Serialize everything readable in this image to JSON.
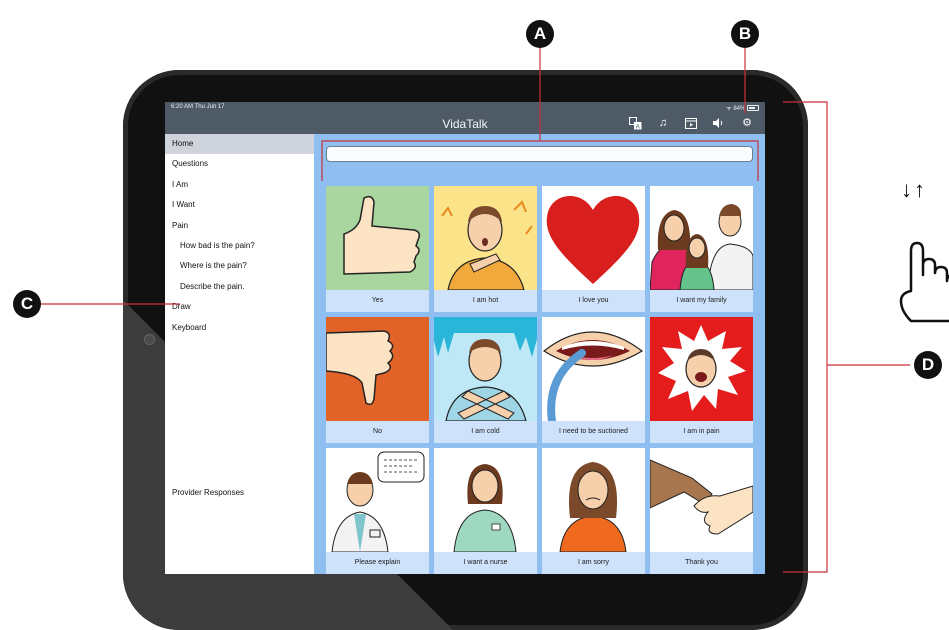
{
  "status": {
    "time": "6:20 AM  Thu Jun 17",
    "battery": "84%"
  },
  "app": {
    "title": "VidaTalk"
  },
  "toolbar": {
    "icons": [
      "translate-icon",
      "music-icon",
      "video-icon",
      "speaker-icon",
      "gear-icon"
    ]
  },
  "sidebar": {
    "items": [
      {
        "label": "Home",
        "active": true
      },
      {
        "label": "Questions"
      },
      {
        "label": "I Am"
      },
      {
        "label": "I Want"
      },
      {
        "label": "Pain"
      },
      {
        "label": "How bad is the pain?",
        "sub": true
      },
      {
        "label": "Where is the pain?",
        "sub": true
      },
      {
        "label": "Describe the pain.",
        "sub": true
      },
      {
        "label": "Draw"
      },
      {
        "label": "Keyboard"
      }
    ],
    "footer": "Provider Responses"
  },
  "board": {
    "tiles": [
      {
        "label": "Yes",
        "icon": "thumbs-up-icon",
        "bg": "#a8d69e"
      },
      {
        "label": "I am hot",
        "icon": "hot-person-icon",
        "bg": "#fbe38a"
      },
      {
        "label": "I love you",
        "icon": "heart-icon",
        "bg": "#ffffff"
      },
      {
        "label": "I want my family",
        "icon": "family-icon",
        "bg": "#ffffff"
      },
      {
        "label": "No",
        "icon": "thumbs-down-icon",
        "bg": "#e26328"
      },
      {
        "label": "I am cold",
        "icon": "cold-person-icon",
        "bg": "#bfe8f6"
      },
      {
        "label": "I need to be suctioned",
        "icon": "suction-icon",
        "bg": "#ffffff"
      },
      {
        "label": "I am in pain",
        "icon": "pain-face-icon",
        "bg": "#e41c1c"
      },
      {
        "label": "Please explain",
        "icon": "doctor-speech-icon",
        "bg": "#ffffff"
      },
      {
        "label": "I want a nurse",
        "icon": "nurse-icon",
        "bg": "#ffffff"
      },
      {
        "label": "I am sorry",
        "icon": "sorry-person-icon",
        "bg": "#ffffff"
      },
      {
        "label": "Thank you",
        "icon": "handshake-icon",
        "bg": "#ffffff"
      }
    ]
  },
  "annotations": {
    "a": "A",
    "b": "B",
    "c": "C",
    "d": "D",
    "gesture_arrows": "↓↑"
  },
  "colors": {
    "accent_line": "#c8323c",
    "board_bg": "#8fbff1",
    "statusbar": "#4e5a66"
  }
}
